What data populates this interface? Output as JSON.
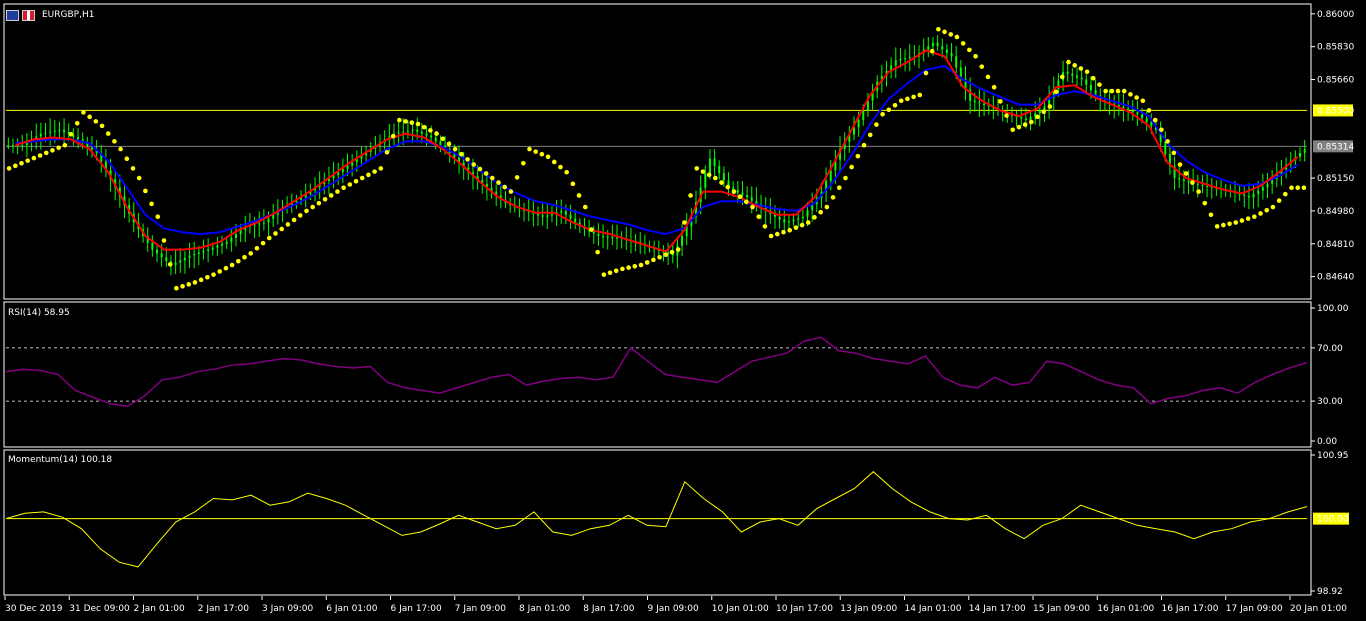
{
  "window": {
    "symbol_title": "EURGBP,H1"
  },
  "colors": {
    "background": "#000000",
    "axes": "#ffffff",
    "candle_bull": "#00ff00",
    "candle_bear": "#00ff00",
    "ma_fast": "#ff0000",
    "ma_slow": "#0000ff",
    "sar": "#ffff00",
    "level_line": "#ffff00",
    "current_price_line": "#808080",
    "rsi": "#800080",
    "momentum": "#ffff00"
  },
  "icons": {
    "flag_left": "eu-flag-icon",
    "flag_right": "gb-flag-icon"
  },
  "chart_data": [
    {
      "type": "candlestick",
      "title": "EURGBP,H1",
      "y_ticks": [
        "0.86000",
        "0.85830",
        "0.85660",
        "0.85500",
        "0.85314",
        "0.85150",
        "0.84980",
        "0.84810",
        "0.84640"
      ],
      "ylim": [
        0.8455,
        0.8603
      ],
      "price_level": {
        "value": 0.855,
        "label": "0.85500"
      },
      "current_price": {
        "value": 0.85314,
        "label": "0.85314"
      },
      "close_series": [
        0.8532,
        0.8538,
        0.854,
        0.8535,
        0.8528,
        0.851,
        0.8492,
        0.8478,
        0.847,
        0.8475,
        0.8478,
        0.8482,
        0.849,
        0.8492,
        0.85,
        0.8505,
        0.8512,
        0.8518,
        0.8525,
        0.8532,
        0.8538,
        0.854,
        0.8536,
        0.8528,
        0.8518,
        0.851,
        0.8502,
        0.8498,
        0.8495,
        0.8498,
        0.849,
        0.8485,
        0.8484,
        0.8482,
        0.8478,
        0.8475,
        0.8495,
        0.8525,
        0.851,
        0.8505,
        0.8498,
        0.8492,
        0.8495,
        0.8508,
        0.853,
        0.8545,
        0.8565,
        0.8576,
        0.8578,
        0.8585,
        0.8578,
        0.8555,
        0.8552,
        0.8548,
        0.8545,
        0.8552,
        0.857,
        0.8566,
        0.8555,
        0.8552,
        0.8548,
        0.854,
        0.8515,
        0.8512,
        0.851,
        0.8508,
        0.8505,
        0.8512,
        0.8522,
        0.853
      ],
      "ma_fast_series": [
        0.8532,
        0.8535,
        0.8536,
        0.8535,
        0.853,
        0.8518,
        0.85,
        0.8485,
        0.8478,
        0.8478,
        0.8479,
        0.8482,
        0.8488,
        0.8492,
        0.8497,
        0.8503,
        0.8509,
        0.8516,
        0.8523,
        0.8529,
        0.8535,
        0.8538,
        0.8536,
        0.853,
        0.8522,
        0.8513,
        0.8505,
        0.85,
        0.8497,
        0.8497,
        0.8492,
        0.8488,
        0.8486,
        0.8483,
        0.848,
        0.8477,
        0.8488,
        0.8508,
        0.8508,
        0.8505,
        0.85,
        0.8496,
        0.8496,
        0.8505,
        0.8522,
        0.854,
        0.8558,
        0.857,
        0.8575,
        0.8581,
        0.8578,
        0.8562,
        0.8555,
        0.855,
        0.8547,
        0.8551,
        0.8562,
        0.8563,
        0.8557,
        0.8553,
        0.8549,
        0.8542,
        0.8523,
        0.8515,
        0.8512,
        0.8509,
        0.8507,
        0.8511,
        0.8518,
        0.8526
      ],
      "ma_slow_series": [
        0.8533,
        0.8534,
        0.8535,
        0.8535,
        0.8533,
        0.8524,
        0.851,
        0.8496,
        0.8489,
        0.8487,
        0.8486,
        0.8487,
        0.849,
        0.8493,
        0.8497,
        0.8501,
        0.8506,
        0.8512,
        0.8518,
        0.8524,
        0.853,
        0.8534,
        0.8534,
        0.8531,
        0.8526,
        0.8519,
        0.8512,
        0.8507,
        0.8503,
        0.8501,
        0.8498,
        0.8495,
        0.8493,
        0.8491,
        0.8488,
        0.8486,
        0.8489,
        0.85,
        0.8503,
        0.8503,
        0.8501,
        0.8499,
        0.8498,
        0.8502,
        0.8513,
        0.8527,
        0.8543,
        0.8556,
        0.8564,
        0.8571,
        0.8573,
        0.8566,
        0.8561,
        0.8557,
        0.8553,
        0.8553,
        0.8558,
        0.856,
        0.8558,
        0.8555,
        0.8552,
        0.8547,
        0.8533,
        0.8524,
        0.8518,
        0.8514,
        0.8511,
        0.8512,
        0.8516,
        0.8522
      ],
      "sar_series": [
        0.852,
        0.8524,
        0.8528,
        0.8532,
        0.8549,
        0.8542,
        0.853,
        0.8515,
        0.8495,
        0.8458,
        0.8461,
        0.8465,
        0.847,
        0.8476,
        0.8484,
        0.8491,
        0.8498,
        0.8504,
        0.851,
        0.8515,
        0.852,
        0.8545,
        0.8543,
        0.8538,
        0.853,
        0.8522,
        0.8515,
        0.8508,
        0.853,
        0.8526,
        0.8518,
        0.85,
        0.8465,
        0.8468,
        0.847,
        0.8474,
        0.8478,
        0.852,
        0.8515,
        0.8508,
        0.85,
        0.8485,
        0.8488,
        0.8492,
        0.85,
        0.8515,
        0.8532,
        0.8548,
        0.8555,
        0.8558,
        0.8592,
        0.8588,
        0.8578,
        0.8562,
        0.854,
        0.8544,
        0.8552,
        0.8575,
        0.857,
        0.856,
        0.856,
        0.8555,
        0.854,
        0.8522,
        0.8508,
        0.849,
        0.8492,
        0.8495,
        0.85,
        0.851
      ]
    },
    {
      "type": "line",
      "title": "RSI(14) 58.95",
      "y_ticks": [
        "100.00",
        "70.00",
        "30.00",
        "0.00"
      ],
      "ylim": [
        0,
        100
      ],
      "levels": [
        70,
        30
      ],
      "values": [
        52,
        54,
        53,
        50,
        38,
        33,
        28,
        26,
        34,
        46,
        48,
        52,
        54,
        57,
        58,
        60,
        62,
        61,
        58,
        56,
        55,
        56,
        44,
        40,
        38,
        36,
        40,
        44,
        48,
        50,
        42,
        45,
        47,
        48,
        46,
        48,
        70,
        60,
        50,
        48,
        46,
        44,
        52,
        60,
        63,
        66,
        75,
        78,
        68,
        66,
        62,
        60,
        58,
        64,
        48,
        42,
        40,
        48,
        42,
        44,
        60,
        58,
        52,
        46,
        42,
        40,
        28,
        32,
        34,
        38,
        40,
        36,
        44,
        50,
        55,
        59
      ]
    },
    {
      "type": "line",
      "title": "Momentum(14) 100.18",
      "y_ticks": [
        "100.95",
        "100.00",
        "98.92"
      ],
      "ylim": [
        98.92,
        100.95
      ],
      "level": 100.0,
      "values": [
        100.0,
        100.08,
        100.1,
        100.02,
        99.85,
        99.55,
        99.35,
        99.28,
        99.62,
        99.95,
        100.1,
        100.3,
        100.28,
        100.35,
        100.2,
        100.25,
        100.38,
        100.3,
        100.2,
        100.05,
        99.9,
        99.75,
        99.8,
        99.92,
        100.05,
        99.95,
        99.85,
        99.9,
        100.1,
        99.8,
        99.75,
        99.85,
        99.9,
        100.05,
        99.9,
        99.88,
        100.55,
        100.3,
        100.1,
        99.8,
        99.95,
        100.0,
        99.9,
        100.15,
        100.3,
        100.45,
        100.7,
        100.45,
        100.25,
        100.1,
        100.0,
        99.98,
        100.05,
        99.85,
        99.7,
        99.9,
        100.0,
        100.2,
        100.1,
        100.0,
        99.9,
        99.85,
        99.8,
        99.7,
        99.8,
        99.85,
        99.95,
        100.0,
        100.1,
        100.18
      ]
    }
  ],
  "time_axis": {
    "labels": [
      "30 Dec 2019",
      "31 Dec 09:00",
      "2 Jan 01:00",
      "2 Jan 17:00",
      "3 Jan 09:00",
      "6 Jan 01:00",
      "6 Jan 17:00",
      "7 Jan 09:00",
      "8 Jan 01:00",
      "8 Jan 17:00",
      "9 Jan 09:00",
      "10 Jan 01:00",
      "10 Jan 17:00",
      "13 Jan 09:00",
      "14 Jan 01:00",
      "14 Jan 17:00",
      "15 Jan 09:00",
      "16 Jan 01:00",
      "16 Jan 17:00",
      "17 Jan 09:00",
      "20 Jan 01:00"
    ]
  }
}
